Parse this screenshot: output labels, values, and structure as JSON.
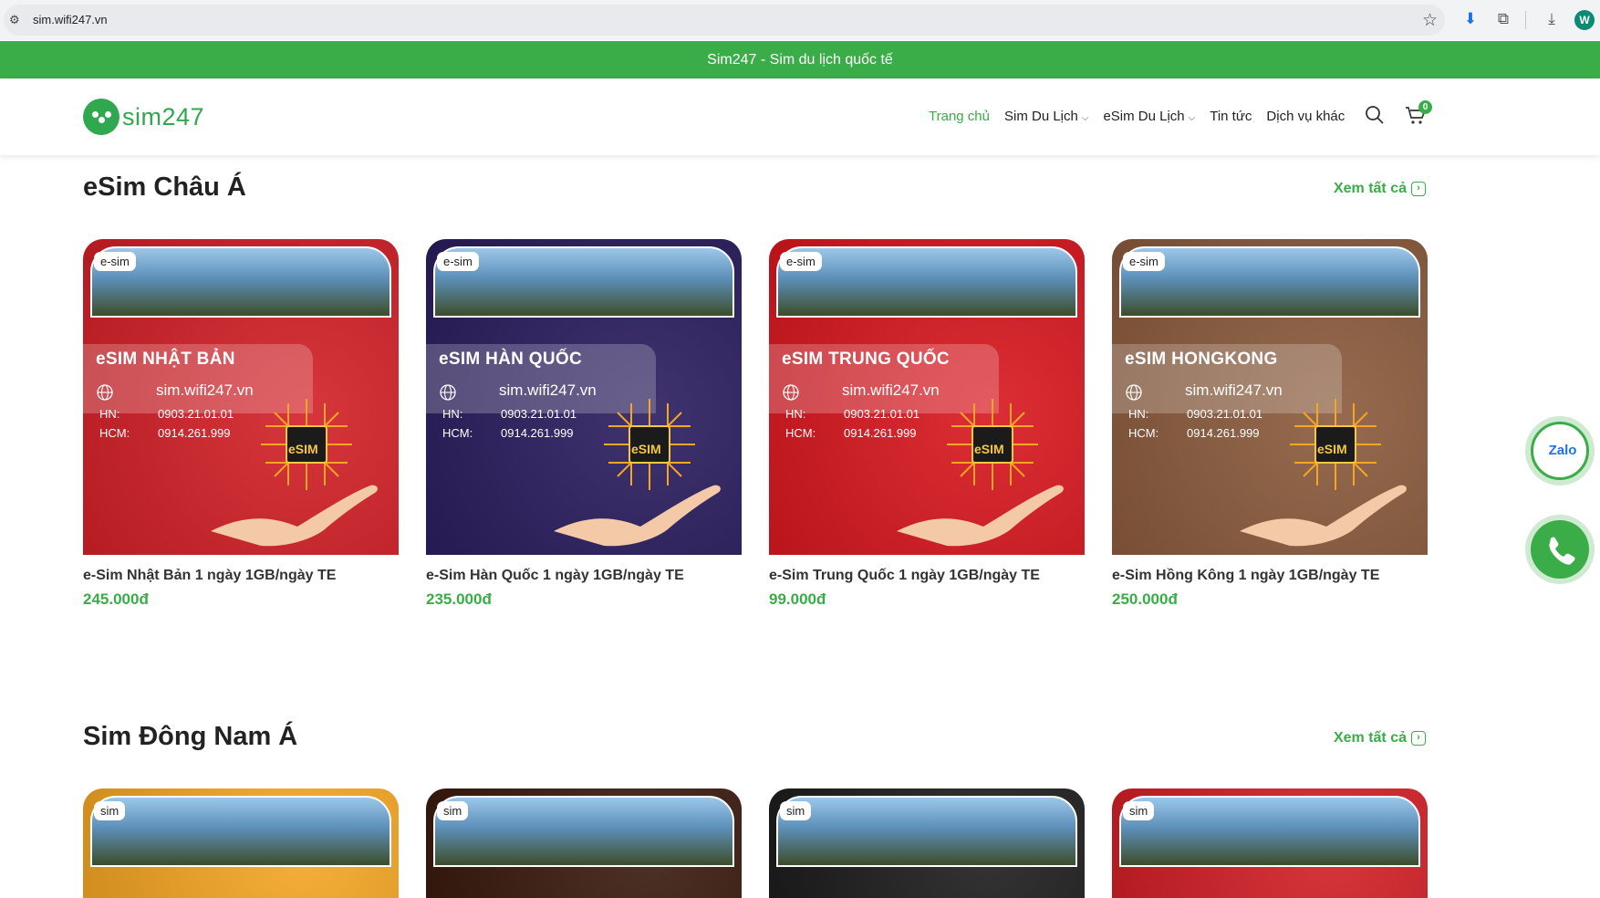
{
  "browser": {
    "url": "sim.wifi247.vn",
    "profile_initial": "W"
  },
  "topbar": {
    "text": "Sim247 - Sim du lịch quốc tế"
  },
  "header": {
    "logo_text": "sim247",
    "nav": [
      {
        "label": "Trang chủ",
        "active": true,
        "dropdown": false
      },
      {
        "label": "Sim Du Lịch",
        "active": false,
        "dropdown": true
      },
      {
        "label": "eSim Du Lịch",
        "active": false,
        "dropdown": true
      },
      {
        "label": "Tin tức",
        "active": false,
        "dropdown": false
      },
      {
        "label": "Dịch vụ khác",
        "active": false,
        "dropdown": false
      }
    ],
    "cart_count": "0"
  },
  "card_common": {
    "site": "sim.wifi247.vn",
    "hn_label": "HN:",
    "hn_phone": "0903.21.01.01",
    "hcm_label": "HCM:",
    "hcm_phone": "0914.261.999",
    "chip_label": "eSIM"
  },
  "sections": [
    {
      "title": "eSim Châu Á",
      "view_all": "Xem tất cả",
      "cards": [
        {
          "tag": "e-sim",
          "card_title": "eSIM NHẬT BẢN",
          "name": "e-Sim Nhật Bản 1 ngày 1GB/ngày TE",
          "price": "245.000đ",
          "bg": "#d21f26"
        },
        {
          "tag": "e-sim",
          "card_title": "eSIM HÀN QUỐC",
          "name": "e-Sim Hàn Quốc 1 ngày 1GB/ngày TE",
          "price": "235.000đ",
          "bg": "#2a1c5e"
        },
        {
          "tag": "e-sim",
          "card_title": "eSIM TRUNG QUỐC",
          "name": "e-Sim Trung Quốc 1 ngày 1GB/ngày TE",
          "price": "99.000đ",
          "bg": "#d8161e"
        },
        {
          "tag": "e-sim",
          "card_title": "eSIM HONGKONG",
          "name": "e-Sim Hồng Kông 1 ngày 1GB/ngày TE",
          "price": "250.000đ",
          "bg": "#8a5a3c"
        }
      ]
    },
    {
      "title": "Sim Đông Nam Á",
      "view_all": "Xem tất cả",
      "cards": [
        {
          "tag": "sim",
          "bg": "#f5a623"
        },
        {
          "tag": "sim",
          "bg": "#3a1a0e"
        },
        {
          "tag": "sim",
          "bg": "#1d1d1d"
        },
        {
          "tag": "sim",
          "bg": "#d21f26"
        }
      ]
    }
  ],
  "floating": {
    "zalo_label": "Zalo"
  }
}
